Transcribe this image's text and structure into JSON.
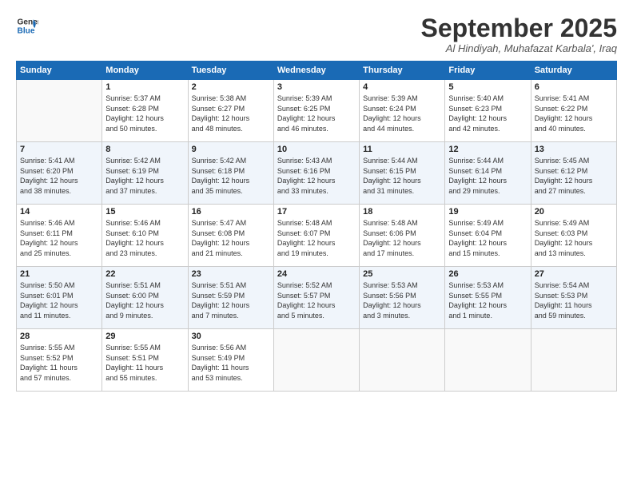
{
  "logo": {
    "line1": "General",
    "line2": "Blue"
  },
  "title": "September 2025",
  "subtitle": "Al Hindiyah, Muhafazat Karbala', Iraq",
  "headers": [
    "Sunday",
    "Monday",
    "Tuesday",
    "Wednesday",
    "Thursday",
    "Friday",
    "Saturday"
  ],
  "weeks": [
    [
      {
        "day": "",
        "info": ""
      },
      {
        "day": "1",
        "info": "Sunrise: 5:37 AM\nSunset: 6:28 PM\nDaylight: 12 hours\nand 50 minutes."
      },
      {
        "day": "2",
        "info": "Sunrise: 5:38 AM\nSunset: 6:27 PM\nDaylight: 12 hours\nand 48 minutes."
      },
      {
        "day": "3",
        "info": "Sunrise: 5:39 AM\nSunset: 6:25 PM\nDaylight: 12 hours\nand 46 minutes."
      },
      {
        "day": "4",
        "info": "Sunrise: 5:39 AM\nSunset: 6:24 PM\nDaylight: 12 hours\nand 44 minutes."
      },
      {
        "day": "5",
        "info": "Sunrise: 5:40 AM\nSunset: 6:23 PM\nDaylight: 12 hours\nand 42 minutes."
      },
      {
        "day": "6",
        "info": "Sunrise: 5:41 AM\nSunset: 6:22 PM\nDaylight: 12 hours\nand 40 minutes."
      }
    ],
    [
      {
        "day": "7",
        "info": "Sunrise: 5:41 AM\nSunset: 6:20 PM\nDaylight: 12 hours\nand 38 minutes."
      },
      {
        "day": "8",
        "info": "Sunrise: 5:42 AM\nSunset: 6:19 PM\nDaylight: 12 hours\nand 37 minutes."
      },
      {
        "day": "9",
        "info": "Sunrise: 5:42 AM\nSunset: 6:18 PM\nDaylight: 12 hours\nand 35 minutes."
      },
      {
        "day": "10",
        "info": "Sunrise: 5:43 AM\nSunset: 6:16 PM\nDaylight: 12 hours\nand 33 minutes."
      },
      {
        "day": "11",
        "info": "Sunrise: 5:44 AM\nSunset: 6:15 PM\nDaylight: 12 hours\nand 31 minutes."
      },
      {
        "day": "12",
        "info": "Sunrise: 5:44 AM\nSunset: 6:14 PM\nDaylight: 12 hours\nand 29 minutes."
      },
      {
        "day": "13",
        "info": "Sunrise: 5:45 AM\nSunset: 6:12 PM\nDaylight: 12 hours\nand 27 minutes."
      }
    ],
    [
      {
        "day": "14",
        "info": "Sunrise: 5:46 AM\nSunset: 6:11 PM\nDaylight: 12 hours\nand 25 minutes."
      },
      {
        "day": "15",
        "info": "Sunrise: 5:46 AM\nSunset: 6:10 PM\nDaylight: 12 hours\nand 23 minutes."
      },
      {
        "day": "16",
        "info": "Sunrise: 5:47 AM\nSunset: 6:08 PM\nDaylight: 12 hours\nand 21 minutes."
      },
      {
        "day": "17",
        "info": "Sunrise: 5:48 AM\nSunset: 6:07 PM\nDaylight: 12 hours\nand 19 minutes."
      },
      {
        "day": "18",
        "info": "Sunrise: 5:48 AM\nSunset: 6:06 PM\nDaylight: 12 hours\nand 17 minutes."
      },
      {
        "day": "19",
        "info": "Sunrise: 5:49 AM\nSunset: 6:04 PM\nDaylight: 12 hours\nand 15 minutes."
      },
      {
        "day": "20",
        "info": "Sunrise: 5:49 AM\nSunset: 6:03 PM\nDaylight: 12 hours\nand 13 minutes."
      }
    ],
    [
      {
        "day": "21",
        "info": "Sunrise: 5:50 AM\nSunset: 6:01 PM\nDaylight: 12 hours\nand 11 minutes."
      },
      {
        "day": "22",
        "info": "Sunrise: 5:51 AM\nSunset: 6:00 PM\nDaylight: 12 hours\nand 9 minutes."
      },
      {
        "day": "23",
        "info": "Sunrise: 5:51 AM\nSunset: 5:59 PM\nDaylight: 12 hours\nand 7 minutes."
      },
      {
        "day": "24",
        "info": "Sunrise: 5:52 AM\nSunset: 5:57 PM\nDaylight: 12 hours\nand 5 minutes."
      },
      {
        "day": "25",
        "info": "Sunrise: 5:53 AM\nSunset: 5:56 PM\nDaylight: 12 hours\nand 3 minutes."
      },
      {
        "day": "26",
        "info": "Sunrise: 5:53 AM\nSunset: 5:55 PM\nDaylight: 12 hours\nand 1 minute."
      },
      {
        "day": "27",
        "info": "Sunrise: 5:54 AM\nSunset: 5:53 PM\nDaylight: 11 hours\nand 59 minutes."
      }
    ],
    [
      {
        "day": "28",
        "info": "Sunrise: 5:55 AM\nSunset: 5:52 PM\nDaylight: 11 hours\nand 57 minutes."
      },
      {
        "day": "29",
        "info": "Sunrise: 5:55 AM\nSunset: 5:51 PM\nDaylight: 11 hours\nand 55 minutes."
      },
      {
        "day": "30",
        "info": "Sunrise: 5:56 AM\nSunset: 5:49 PM\nDaylight: 11 hours\nand 53 minutes."
      },
      {
        "day": "",
        "info": ""
      },
      {
        "day": "",
        "info": ""
      },
      {
        "day": "",
        "info": ""
      },
      {
        "day": "",
        "info": ""
      }
    ]
  ]
}
